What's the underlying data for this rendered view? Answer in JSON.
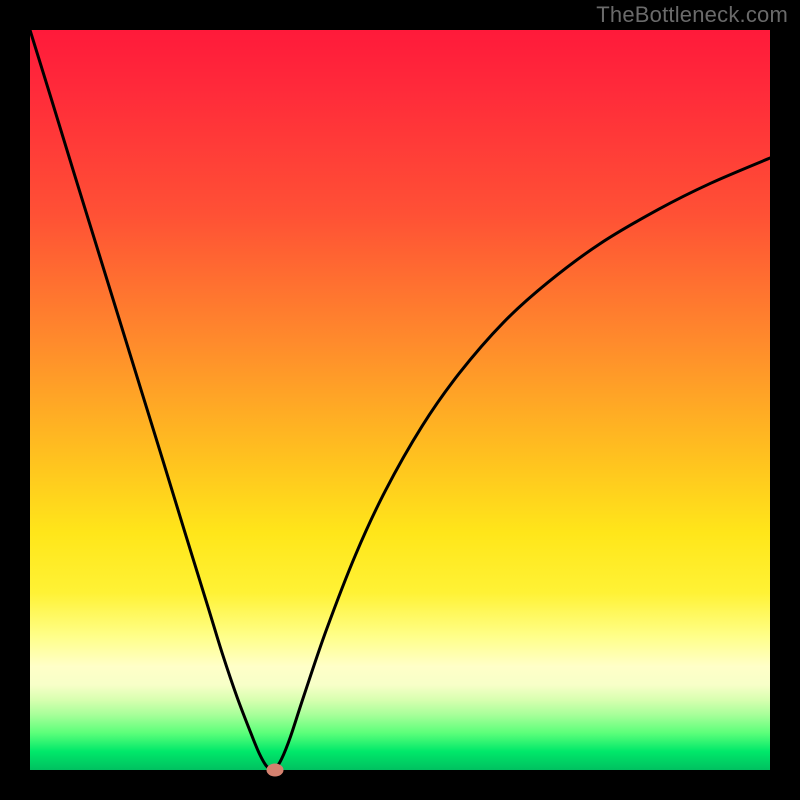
{
  "watermark": "TheBottleneck.com",
  "chart_data": {
    "type": "line",
    "title": "",
    "xlabel": "",
    "ylabel": "",
    "xlim": [
      0,
      100
    ],
    "ylim": [
      0,
      100
    ],
    "grid": false,
    "series": [
      {
        "name": "curve",
        "x": [
          0,
          3,
          6,
          9,
          12,
          15,
          18,
          21,
          24,
          26,
          28,
          30,
          31,
          31.9,
          32.5,
          33.2,
          34.0,
          35.2,
          37.0,
          40.0,
          44.0,
          48.0,
          53.0,
          58.0,
          64.0,
          70.0,
          77.0,
          85.0,
          92.0,
          100.0
        ],
        "y": [
          100,
          90.3,
          80.5,
          70.8,
          61.1,
          51.4,
          41.7,
          31.9,
          22.2,
          15.7,
          9.8,
          4.6,
          2.2,
          0.6,
          0.15,
          0.3,
          1.5,
          4.5,
          10.0,
          18.8,
          29.1,
          37.7,
          46.5,
          53.6,
          60.5,
          65.9,
          71.1,
          75.8,
          79.3,
          82.7
        ]
      }
    ],
    "marker": {
      "x": 33.1,
      "y": 0.0
    },
    "background_gradient": {
      "top": "#ff1a3a",
      "mid": "#ffe61a",
      "bottom": "#00c060"
    }
  }
}
